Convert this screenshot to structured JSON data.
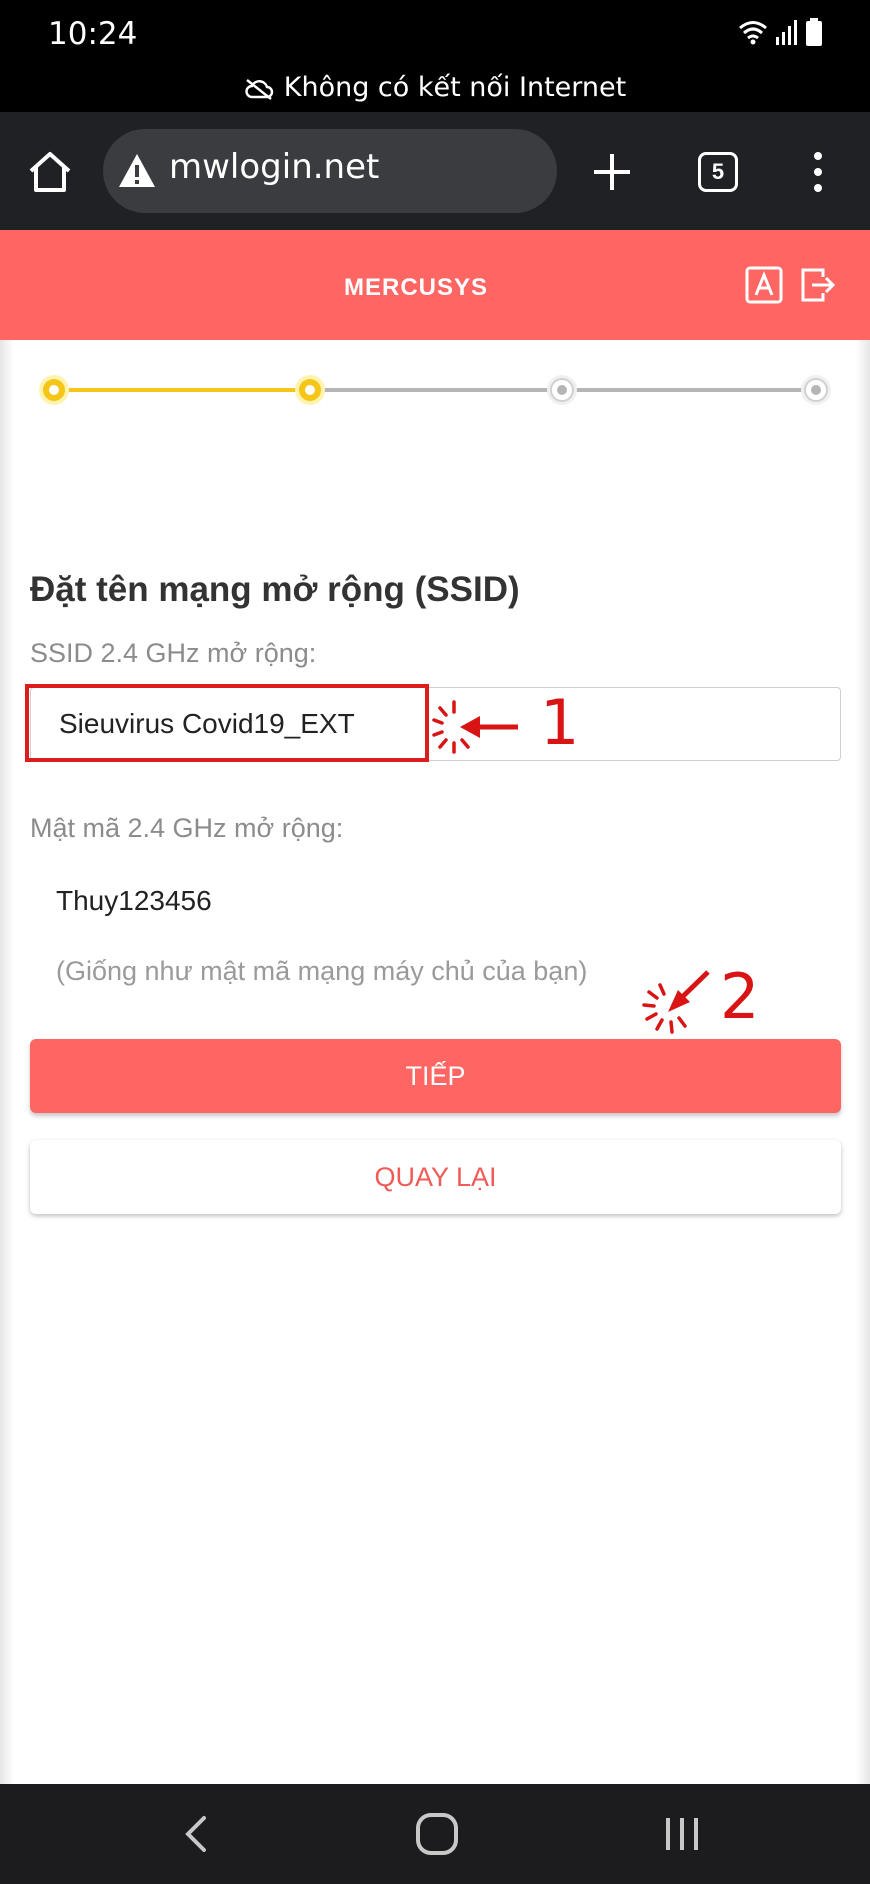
{
  "status_bar": {
    "time": "10:24",
    "notice": "Không có kết nối Internet",
    "icons": [
      "wifi-icon",
      "signal-icon",
      "battery-icon"
    ]
  },
  "browser": {
    "url": "mwlogin.net",
    "tab_count": "5",
    "icons": [
      "home-icon",
      "warning-icon",
      "plus-icon",
      "more-icon"
    ]
  },
  "header": {
    "logo": "MERCUSYS",
    "color": "#fd6663",
    "icons": [
      "language-icon",
      "logout-icon"
    ]
  },
  "progress": {
    "steps_total": 4,
    "steps_done": 2,
    "active_color": "#f5c518",
    "inactive_color": "#b5b5b5"
  },
  "form": {
    "title": "Đặt tên mạng mở rộng (SSID)",
    "ssid_label": "SSID 2.4 GHz mở rộng:",
    "ssid_value": "Sieuvirus Covid19_EXT",
    "password_label": "Mật mã 2.4 GHz mở rộng:",
    "password_value": "Thuy123456",
    "hint": "(Giống như mật mã mạng máy chủ của bạn)"
  },
  "buttons": {
    "next": "TIẾP",
    "back": "QUAY LẠI"
  },
  "annotations": {
    "marker_1": "1",
    "marker_2": "2",
    "color": "#d91414"
  },
  "nav_bar": {
    "icons": [
      "back-icon",
      "home-icon",
      "recent-apps-icon"
    ]
  }
}
